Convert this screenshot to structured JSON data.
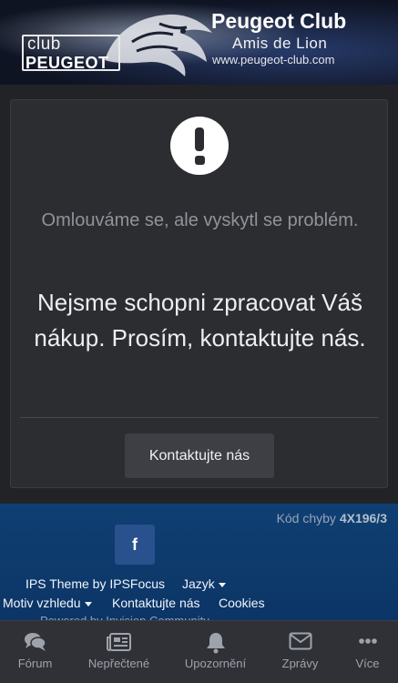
{
  "header": {
    "logo_club": "club",
    "logo_brand": "PEUGEOT",
    "title": "Peugeot Club",
    "subtitle": "Amis de Lion",
    "url": "www.peugeot-club.com"
  },
  "error": {
    "subtitle": "Omlouváme se, ale vyskytl se problém.",
    "message": "Nejsme schopni zpracovat Váš nákup. Prosím, kontaktujte nás.",
    "contact_button": "Kontaktujte nás",
    "code_label": "Kód chyby",
    "code_value": "4X196/3"
  },
  "footer": {
    "facebook_label": "f",
    "theme_credit": "IPS Theme by IPSFocus",
    "language": "Jazyk",
    "theme_picker": "Motiv vzhledu",
    "contact": "Kontaktujte nás",
    "cookies": "Cookies",
    "powered_by": "Powered by Invision Community"
  },
  "bottom_nav": {
    "items": [
      {
        "label": "Fórum",
        "icon": "comments-icon"
      },
      {
        "label": "Nepřečtené",
        "icon": "newspaper-icon"
      },
      {
        "label": "Upozornění",
        "icon": "bell-icon"
      },
      {
        "label": "Zprávy",
        "icon": "envelope-icon"
      },
      {
        "label": "Více",
        "icon": "more-icon"
      }
    ]
  },
  "colors": {
    "background": "#222326",
    "card": "#2c2d31",
    "footer": "#0f3f73",
    "nav": "#2f3137"
  }
}
